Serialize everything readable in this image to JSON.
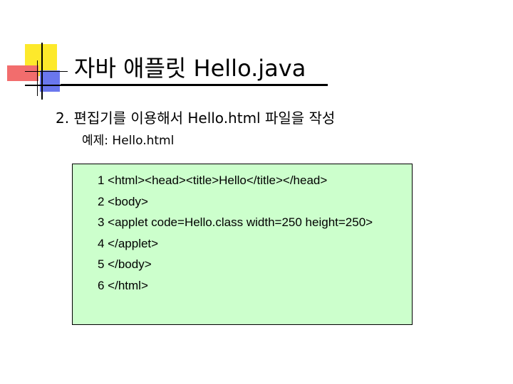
{
  "slide": {
    "title": "자바 애플릿 Hello.java",
    "bullet": "2. 편집기를 이용해서 Hello.html 파일을 작성",
    "example": "예제: Hello.html",
    "code_lines": [
      "1 <html><head><title>Hello</title></head>",
      "2 <body>",
      "3 <applet code=Hello.class width=250 height=250>",
      "4 </applet>",
      "5 </body>",
      "6 </html>"
    ]
  },
  "colors": {
    "code_background": "#ccffcc",
    "logo_yellow": "#fde92b",
    "logo_red": "#f26d6d",
    "logo_blue": "#6a77ee"
  }
}
